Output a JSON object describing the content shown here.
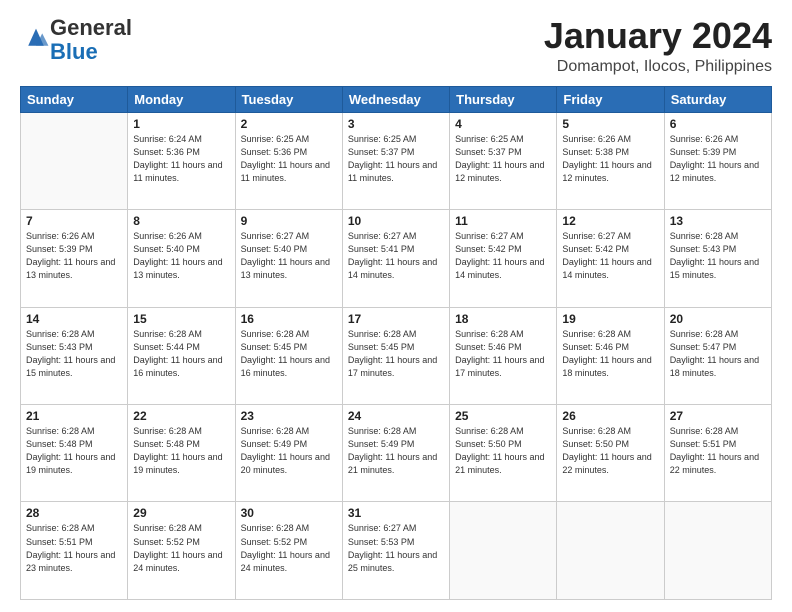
{
  "logo": {
    "general": "General",
    "blue": "Blue"
  },
  "title": "January 2024",
  "location": "Domampot, Ilocos, Philippines",
  "days_header": [
    "Sunday",
    "Monday",
    "Tuesday",
    "Wednesday",
    "Thursday",
    "Friday",
    "Saturday"
  ],
  "weeks": [
    [
      {
        "day": "",
        "sunrise": "",
        "sunset": "",
        "daylight": ""
      },
      {
        "day": "1",
        "sunrise": "Sunrise: 6:24 AM",
        "sunset": "Sunset: 5:36 PM",
        "daylight": "Daylight: 11 hours and 11 minutes."
      },
      {
        "day": "2",
        "sunrise": "Sunrise: 6:25 AM",
        "sunset": "Sunset: 5:36 PM",
        "daylight": "Daylight: 11 hours and 11 minutes."
      },
      {
        "day": "3",
        "sunrise": "Sunrise: 6:25 AM",
        "sunset": "Sunset: 5:37 PM",
        "daylight": "Daylight: 11 hours and 11 minutes."
      },
      {
        "day": "4",
        "sunrise": "Sunrise: 6:25 AM",
        "sunset": "Sunset: 5:37 PM",
        "daylight": "Daylight: 11 hours and 12 minutes."
      },
      {
        "day": "5",
        "sunrise": "Sunrise: 6:26 AM",
        "sunset": "Sunset: 5:38 PM",
        "daylight": "Daylight: 11 hours and 12 minutes."
      },
      {
        "day": "6",
        "sunrise": "Sunrise: 6:26 AM",
        "sunset": "Sunset: 5:39 PM",
        "daylight": "Daylight: 11 hours and 12 minutes."
      }
    ],
    [
      {
        "day": "7",
        "sunrise": "Sunrise: 6:26 AM",
        "sunset": "Sunset: 5:39 PM",
        "daylight": "Daylight: 11 hours and 13 minutes."
      },
      {
        "day": "8",
        "sunrise": "Sunrise: 6:26 AM",
        "sunset": "Sunset: 5:40 PM",
        "daylight": "Daylight: 11 hours and 13 minutes."
      },
      {
        "day": "9",
        "sunrise": "Sunrise: 6:27 AM",
        "sunset": "Sunset: 5:40 PM",
        "daylight": "Daylight: 11 hours and 13 minutes."
      },
      {
        "day": "10",
        "sunrise": "Sunrise: 6:27 AM",
        "sunset": "Sunset: 5:41 PM",
        "daylight": "Daylight: 11 hours and 14 minutes."
      },
      {
        "day": "11",
        "sunrise": "Sunrise: 6:27 AM",
        "sunset": "Sunset: 5:42 PM",
        "daylight": "Daylight: 11 hours and 14 minutes."
      },
      {
        "day": "12",
        "sunrise": "Sunrise: 6:27 AM",
        "sunset": "Sunset: 5:42 PM",
        "daylight": "Daylight: 11 hours and 14 minutes."
      },
      {
        "day": "13",
        "sunrise": "Sunrise: 6:28 AM",
        "sunset": "Sunset: 5:43 PM",
        "daylight": "Daylight: 11 hours and 15 minutes."
      }
    ],
    [
      {
        "day": "14",
        "sunrise": "Sunrise: 6:28 AM",
        "sunset": "Sunset: 5:43 PM",
        "daylight": "Daylight: 11 hours and 15 minutes."
      },
      {
        "day": "15",
        "sunrise": "Sunrise: 6:28 AM",
        "sunset": "Sunset: 5:44 PM",
        "daylight": "Daylight: 11 hours and 16 minutes."
      },
      {
        "day": "16",
        "sunrise": "Sunrise: 6:28 AM",
        "sunset": "Sunset: 5:45 PM",
        "daylight": "Daylight: 11 hours and 16 minutes."
      },
      {
        "day": "17",
        "sunrise": "Sunrise: 6:28 AM",
        "sunset": "Sunset: 5:45 PM",
        "daylight": "Daylight: 11 hours and 17 minutes."
      },
      {
        "day": "18",
        "sunrise": "Sunrise: 6:28 AM",
        "sunset": "Sunset: 5:46 PM",
        "daylight": "Daylight: 11 hours and 17 minutes."
      },
      {
        "day": "19",
        "sunrise": "Sunrise: 6:28 AM",
        "sunset": "Sunset: 5:46 PM",
        "daylight": "Daylight: 11 hours and 18 minutes."
      },
      {
        "day": "20",
        "sunrise": "Sunrise: 6:28 AM",
        "sunset": "Sunset: 5:47 PM",
        "daylight": "Daylight: 11 hours and 18 minutes."
      }
    ],
    [
      {
        "day": "21",
        "sunrise": "Sunrise: 6:28 AM",
        "sunset": "Sunset: 5:48 PM",
        "daylight": "Daylight: 11 hours and 19 minutes."
      },
      {
        "day": "22",
        "sunrise": "Sunrise: 6:28 AM",
        "sunset": "Sunset: 5:48 PM",
        "daylight": "Daylight: 11 hours and 19 minutes."
      },
      {
        "day": "23",
        "sunrise": "Sunrise: 6:28 AM",
        "sunset": "Sunset: 5:49 PM",
        "daylight": "Daylight: 11 hours and 20 minutes."
      },
      {
        "day": "24",
        "sunrise": "Sunrise: 6:28 AM",
        "sunset": "Sunset: 5:49 PM",
        "daylight": "Daylight: 11 hours and 21 minutes."
      },
      {
        "day": "25",
        "sunrise": "Sunrise: 6:28 AM",
        "sunset": "Sunset: 5:50 PM",
        "daylight": "Daylight: 11 hours and 21 minutes."
      },
      {
        "day": "26",
        "sunrise": "Sunrise: 6:28 AM",
        "sunset": "Sunset: 5:50 PM",
        "daylight": "Daylight: 11 hours and 22 minutes."
      },
      {
        "day": "27",
        "sunrise": "Sunrise: 6:28 AM",
        "sunset": "Sunset: 5:51 PM",
        "daylight": "Daylight: 11 hours and 22 minutes."
      }
    ],
    [
      {
        "day": "28",
        "sunrise": "Sunrise: 6:28 AM",
        "sunset": "Sunset: 5:51 PM",
        "daylight": "Daylight: 11 hours and 23 minutes."
      },
      {
        "day": "29",
        "sunrise": "Sunrise: 6:28 AM",
        "sunset": "Sunset: 5:52 PM",
        "daylight": "Daylight: 11 hours and 24 minutes."
      },
      {
        "day": "30",
        "sunrise": "Sunrise: 6:28 AM",
        "sunset": "Sunset: 5:52 PM",
        "daylight": "Daylight: 11 hours and 24 minutes."
      },
      {
        "day": "31",
        "sunrise": "Sunrise: 6:27 AM",
        "sunset": "Sunset: 5:53 PM",
        "daylight": "Daylight: 11 hours and 25 minutes."
      },
      {
        "day": "",
        "sunrise": "",
        "sunset": "",
        "daylight": ""
      },
      {
        "day": "",
        "sunrise": "",
        "sunset": "",
        "daylight": ""
      },
      {
        "day": "",
        "sunrise": "",
        "sunset": "",
        "daylight": ""
      }
    ]
  ]
}
